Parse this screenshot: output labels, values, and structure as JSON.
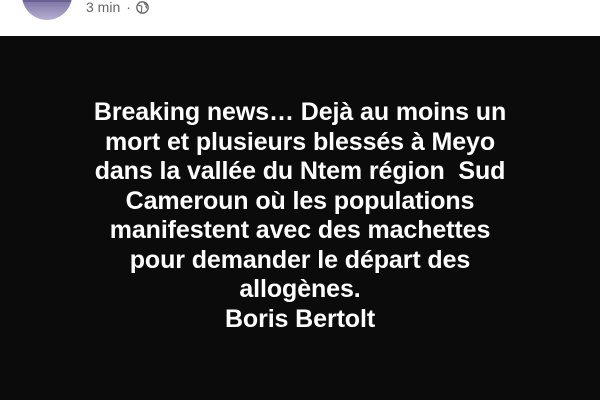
{
  "post": {
    "timestamp": "3 min",
    "separator": "·",
    "privacy_icon": "globe-icon",
    "body_lines": [
      "Breaking news… Dejà au moins un",
      "mort et plusieurs blessés à Meyo",
      "dans la vallée du Ntem région  Sud",
      "Cameroun où les populations",
      "manifestent avec des machettes",
      "pour demander le départ des",
      "allogènes.",
      "Boris Bertolt"
    ],
    "background_color": "#0b0b0b",
    "text_color": "#ffffff"
  }
}
